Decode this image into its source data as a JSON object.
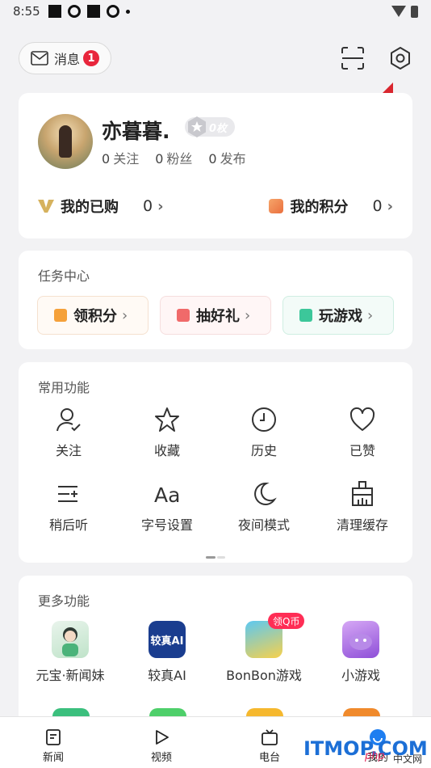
{
  "status_bar": {
    "time": "8:55"
  },
  "header": {
    "messages_label": "消息",
    "messages_badge": "1",
    "scan_icon": "scan-icon",
    "settings_icon": "gear-icon"
  },
  "profile": {
    "username": "亦暮暮.",
    "coin_badge": "0枚",
    "following_count": "0",
    "following_label": "关注",
    "fans_count": "0",
    "fans_label": "粉丝",
    "posts_count": "0",
    "posts_label": "发布",
    "purchased_label": "我的已购",
    "purchased_value": "0",
    "points_label": "我的积分",
    "points_value": "0"
  },
  "tasks": {
    "title": "任务中心",
    "items": [
      {
        "label": "领积分",
        "icon": "gift-icon",
        "color": "#f5a13a"
      },
      {
        "label": "抽好礼",
        "icon": "ticket-icon",
        "color": "#f06a6a"
      },
      {
        "label": "玩游戏",
        "icon": "gamepad-icon",
        "color": "#3cc79a"
      }
    ]
  },
  "common": {
    "title": "常用功能",
    "items": [
      {
        "label": "关注",
        "icon": "user-check-icon"
      },
      {
        "label": "收藏",
        "icon": "star-icon"
      },
      {
        "label": "历史",
        "icon": "clock-icon"
      },
      {
        "label": "已赞",
        "icon": "heart-icon"
      },
      {
        "label": "稍后听",
        "icon": "list-add-icon"
      },
      {
        "label": "字号设置",
        "icon": "font-size-icon"
      },
      {
        "label": "夜间模式",
        "icon": "moon-icon"
      },
      {
        "label": "清理缓存",
        "icon": "broom-icon"
      }
    ]
  },
  "more": {
    "title": "更多功能",
    "items": [
      {
        "label": "元宝·新闻妹",
        "icon": "yuanbao-icon"
      },
      {
        "label": "较真AI",
        "icon": "jiaozhen-ai-icon",
        "icon_text": "较真AI"
      },
      {
        "label": "BonBon游戏",
        "icon": "bonbon-game-icon",
        "promo": "领Q币"
      },
      {
        "label": "小游戏",
        "icon": "mini-game-icon"
      }
    ]
  },
  "tabbar": {
    "items": [
      {
        "label": "新闻",
        "icon": "news-icon"
      },
      {
        "label": "视频",
        "icon": "play-icon"
      },
      {
        "label": "电台",
        "icon": "radio-icon"
      },
      {
        "label": "我的",
        "icon": "profile-icon"
      }
    ]
  },
  "watermark": {
    "brand": "ITMOP.COM",
    "small": "中文网",
    "php": "php"
  },
  "colors": {
    "accent_red": "#e8263c",
    "background": "#f2f2f4",
    "arrow": "#d9262e"
  }
}
